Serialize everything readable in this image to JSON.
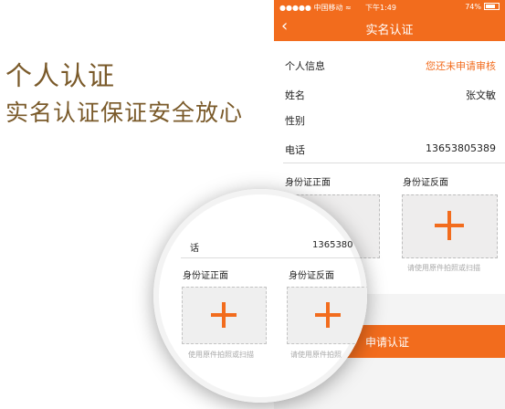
{
  "promo": {
    "title": "个人认证",
    "subtitle": "实名认证保证安全放心"
  },
  "status_bar": {
    "carrier": "●●●●● 中国移动",
    "wifi_icon": "wifi-icon",
    "time": "下午1:49",
    "battery": "74%"
  },
  "nav": {
    "back_icon": "back-chevron-icon",
    "title": "实名认证"
  },
  "personal_info": {
    "header_label": "个人信息",
    "status": "您还未申请审核",
    "rows": [
      {
        "label": "姓名",
        "value": "张文敏"
      },
      {
        "label": "性别",
        "value": ""
      },
      {
        "label": "电话",
        "value": "13653805389"
      }
    ]
  },
  "id_card": {
    "front_label": "身份证正面",
    "back_label": "身份证反面",
    "upload_hint": "请使用原件拍照或扫描",
    "plus_icon": "plus-icon"
  },
  "submit_label": "申请认证",
  "magnifier": {
    "phone_label_fragment": "话",
    "phone_value_fragment": "1365380",
    "front_label": "身份证正面",
    "back_label": "身份证反面",
    "front_hint_fragment": "使用原件拍照或扫描",
    "back_hint_fragment": "请使用原件拍照"
  },
  "colors": {
    "accent": "#f26c1d",
    "promo_text": "#7a5a2a",
    "upload_bg": "#eeeded"
  }
}
